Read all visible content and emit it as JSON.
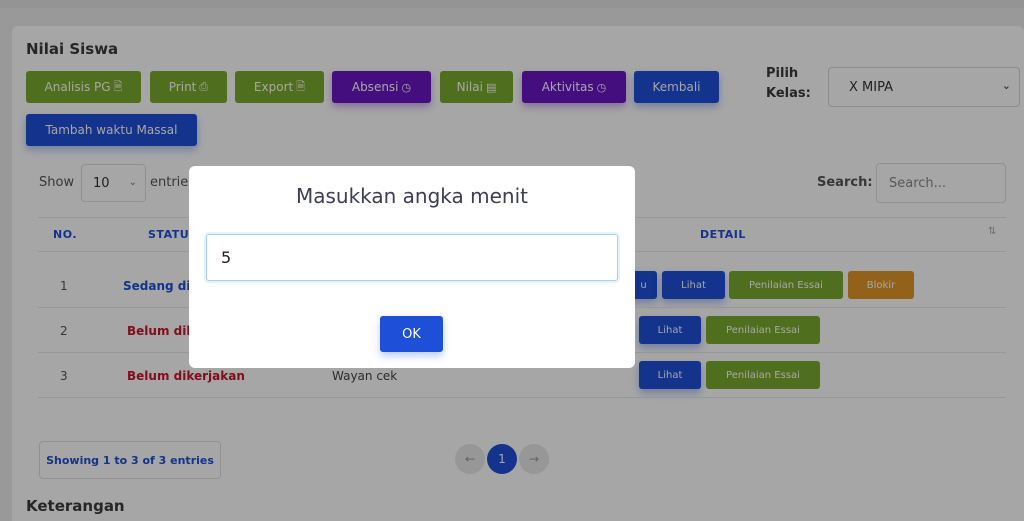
{
  "page": {
    "title": "Nilai Siswa",
    "footer_heading": "Keterangan"
  },
  "toolbar": {
    "analisis_label": "Analisis PG",
    "print_label": "Print",
    "export_label": "Export",
    "absensi_label": "Absensi",
    "nilai_label": "Nilai",
    "aktivitas_label": "Aktivitas",
    "kembali_label": "Kembali",
    "tambah_label": "Tambah waktu Massal"
  },
  "class_filter": {
    "label": "Pilih Kelas:",
    "selected": "X MIPA"
  },
  "table_controls": {
    "show_label": "Show",
    "entries_value": "10",
    "entries_label": "entries",
    "search_label": "Search:",
    "search_placeholder": "Search..."
  },
  "table": {
    "headers": {
      "no": "NO.",
      "status": "STATUS",
      "detail": "DETAIL"
    },
    "rows": [
      {
        "no": "1",
        "status": "Sedang dik",
        "name": "",
        "actions": [
          "u",
          "Lihat",
          "Penilaian Essai",
          "Blokir"
        ]
      },
      {
        "no": "2",
        "status": "Belum dike",
        "name": "",
        "actions": [
          "Lihat",
          "Penilaian Essai"
        ]
      },
      {
        "no": "3",
        "status": "Belum dikerjakan",
        "name": "Wayan cek",
        "actions": [
          "Lihat",
          "Penilaian Essai"
        ]
      }
    ]
  },
  "pagination": {
    "info": "Showing 1 to 3 of 3 entries",
    "prev": "←",
    "current": "1",
    "next": "→"
  },
  "modal": {
    "title": "Masukkan angka menit",
    "input_value": "5",
    "ok_label": "OK"
  },
  "colors": {
    "green": "#7cab2f",
    "purple": "#6a16c4",
    "blue": "#1e4fd8",
    "orange": "#e0972a",
    "red": "#c8142b"
  },
  "icons": {
    "analisis": "file-download-icon",
    "print": "printer-icon",
    "export": "file-export-icon",
    "absensi": "clock-icon",
    "nilai": "grade-book-icon",
    "aktivitas": "clock-icon"
  }
}
